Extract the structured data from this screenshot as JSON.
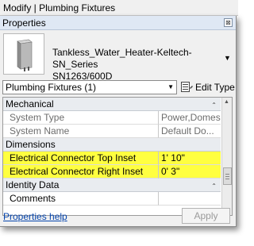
{
  "window": {
    "title": "Modify | Plumbing Fixtures"
  },
  "panel": {
    "title": "Properties",
    "close_glyph": "⊠"
  },
  "type_selector": {
    "name_line1": "Tankless_Water_Heater-Keltech-SN_Series",
    "name_line2": "SN1263/600D"
  },
  "filter": {
    "selected": "Plumbing Fixtures (1)"
  },
  "edit_type": {
    "label": "Edit Type"
  },
  "groups": {
    "mechanical": {
      "title": "Mechanical",
      "rows": [
        {
          "name": "System Type",
          "value": "Power,Domes..."
        },
        {
          "name": "System Name",
          "value": "Default Do..."
        }
      ]
    },
    "dimensions": {
      "title": "Dimensions",
      "rows": [
        {
          "name": "Electrical Connector Top Inset",
          "value": "1'  10\""
        },
        {
          "name": "Electrical Connector Right Inset",
          "value": "0'  3\""
        }
      ]
    },
    "identity": {
      "title": "Identity Data",
      "rows": [
        {
          "name": "Comments",
          "value": ""
        }
      ]
    }
  },
  "footer": {
    "help_label": "Properties help",
    "apply_label": "Apply"
  },
  "colors": {
    "highlight": "#ffff40",
    "section_bg": "#e9ecf0",
    "link": "#0645ad"
  }
}
